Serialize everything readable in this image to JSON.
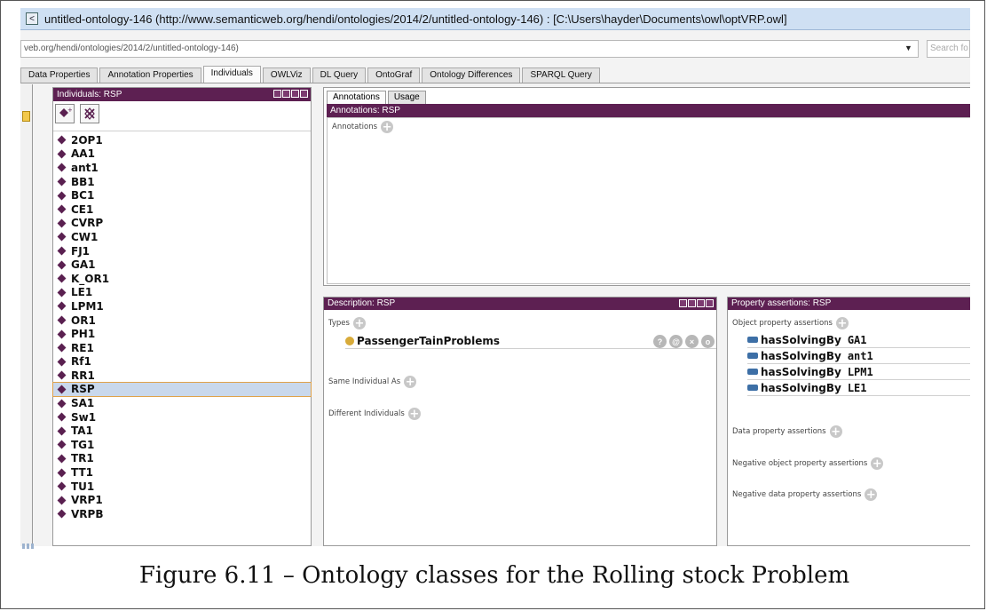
{
  "window": {
    "title": "untitled-ontology-146 (http://www.semanticweb.org/hendi/ontologies/2014/2/untitled-ontology-146)  : [C:\\Users\\hayder\\Documents\\owl\\optVRP.owl]"
  },
  "address_bar": {
    "value": "veb.org/hendi/ontologies/2014/2/untitled-ontology-146)",
    "search_placeholder": "Search fo"
  },
  "tabs": [
    {
      "label": "Data Properties"
    },
    {
      "label": "Annotation Properties"
    },
    {
      "label": "Individuals",
      "active": true
    },
    {
      "label": "OWLViz"
    },
    {
      "label": "DL Query"
    },
    {
      "label": "OntoGraf"
    },
    {
      "label": "Ontology Differences"
    },
    {
      "label": "SPARQL Query"
    }
  ],
  "individuals_panel": {
    "title": "Individuals: RSP",
    "items": [
      "2OP1",
      "AA1",
      "ant1",
      "BB1",
      "BC1",
      "CE1",
      "CVRP",
      "CW1",
      "FJ1",
      "GA1",
      "K_OR1",
      "LE1",
      "LPM1",
      "OR1",
      "PH1",
      "RE1",
      "Rf1",
      "RR1",
      "RSP",
      "SA1",
      "Sw1",
      "TA1",
      "TG1",
      "TR1",
      "TT1",
      "TU1",
      "VRP1",
      "VRPB"
    ],
    "selected": "RSP"
  },
  "annotations_panel": {
    "tabs": [
      "Annotations",
      "Usage"
    ],
    "header": "Annotations: RSP",
    "section_label": "Annotations"
  },
  "description_panel": {
    "header": "Description: RSP",
    "types_label": "Types",
    "type_value": "PassengerTainProblems",
    "same_label": "Same Individual As",
    "different_label": "Different Individuals"
  },
  "property_panel": {
    "header": "Property assertions: RSP",
    "object_label": "Object property assertions",
    "assertions": [
      {
        "property": "hasSolvingBy",
        "individual": "GA1"
      },
      {
        "property": "hasSolvingBy",
        "individual": "ant1"
      },
      {
        "property": "hasSolvingBy",
        "individual": "LPM1"
      },
      {
        "property": "hasSolvingBy",
        "individual": "LE1"
      }
    ],
    "data_label": "Data property assertions",
    "neg_object_label": "Negative object property assertions",
    "neg_data_label": "Negative data property assertions"
  },
  "caption": "Figure 6.11 – Ontology classes for the Rolling stock Problem",
  "colors": {
    "header_purple": "#5d2052",
    "selection": "#c9d8ec",
    "class_dot": "#d8ab3a",
    "property_bar": "#3d6fa6"
  },
  "icons": [
    "app-icon",
    "add-individual-icon",
    "delete-individual-icon",
    "individual-diamond-icon",
    "class-dot-icon",
    "object-property-icon",
    "add-icon",
    "help-icon",
    "annotate-icon",
    "delete-icon",
    "edit-icon"
  ]
}
